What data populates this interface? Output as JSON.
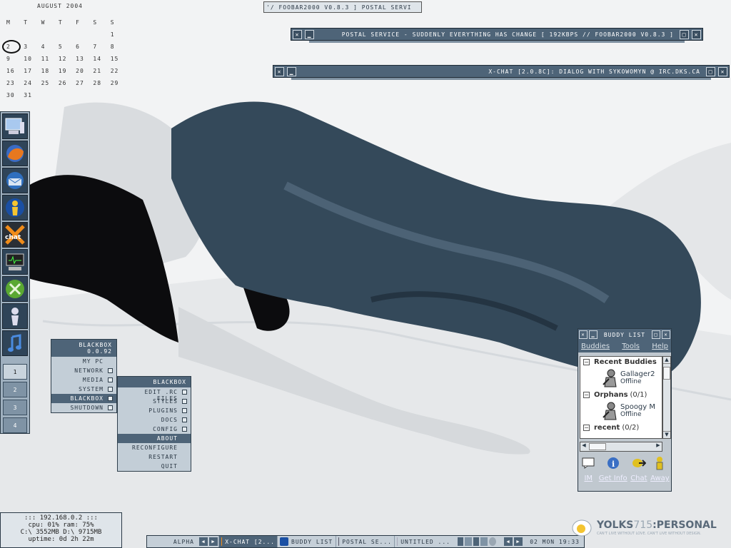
{
  "calendar": {
    "month": "AUGUST 2004",
    "weekdays": [
      "M",
      "T",
      "W",
      "T",
      "F",
      "S",
      "S"
    ],
    "weeks": [
      [
        "",
        "",
        "",
        "",
        "",
        "",
        "1"
      ],
      [
        "2",
        "3",
        "4",
        "5",
        "6",
        "7",
        "8"
      ],
      [
        "9",
        "10",
        "11",
        "12",
        "13",
        "14",
        "15"
      ],
      [
        "16",
        "17",
        "18",
        "19",
        "20",
        "21",
        "22"
      ],
      [
        "23",
        "24",
        "25",
        "26",
        "27",
        "28",
        "29"
      ],
      [
        "30",
        "31",
        "",
        "",
        "",
        "",
        ""
      ]
    ],
    "today": "2"
  },
  "windows": {
    "foobar_tab": "'/ FOOBAR2000 V0.8.3 ]      POSTAL SERVI",
    "foobar_title": "POSTAL SERVICE - SUDDENLY EVERYTHING HAS CHANGE  [ 192KBPS // FOOBAR2000 V0.8.3 ]",
    "xchat_title": "X-CHAT [2.0.8C]: DIALOG WITH SYKOWOMYN @ IRC.DKS.CA"
  },
  "dock": {
    "icons": [
      "my-computer-icon",
      "firefox-icon",
      "thunderbird-icon",
      "aim-icon",
      "xchat-icon",
      "terminal-icon",
      "xbox-icon",
      "figure-icon",
      "music-note-icon"
    ],
    "workspaces": [
      "1",
      "2",
      "3",
      "4"
    ],
    "current_workspace": "1"
  },
  "blackbox_menu": {
    "title": "BLACKBOX 0.0.92",
    "items": [
      {
        "label": "MY PC",
        "sub": false
      },
      {
        "label": "NETWORK",
        "sub": true
      },
      {
        "label": "MEDIA",
        "sub": true
      },
      {
        "label": "SYSTEM",
        "sub": true
      },
      {
        "label": "BLACKBOX",
        "sub": true,
        "selected": true
      },
      {
        "label": "SHUTDOWN",
        "sub": true
      }
    ]
  },
  "blackbox_submenu": {
    "title": "BLACKBOX",
    "items": [
      {
        "label": "EDIT .RC FILES",
        "sub": true
      },
      {
        "label": "STYLES",
        "sub": true
      },
      {
        "label": "PLUGINS",
        "sub": true
      },
      {
        "label": "DOCS",
        "sub": true
      },
      {
        "label": "CONFIG",
        "sub": true
      },
      {
        "label": "ABOUT",
        "sub": false,
        "selected": true
      },
      {
        "label": "RECONFIGURE",
        "sub": false
      },
      {
        "label": "RESTART",
        "sub": false
      },
      {
        "label": "QUIT",
        "sub": false
      }
    ]
  },
  "buddy_list": {
    "title": "BUDDY LIST",
    "menu": [
      "Buddies",
      "Tools",
      "Help"
    ],
    "groups": [
      {
        "name": "Recent Buddies",
        "count": "",
        "buddies": [
          {
            "name": "Gallager2",
            "status": "Offline"
          }
        ]
      },
      {
        "name": "Orphans",
        "count": "(0/1)",
        "buddies": [
          {
            "name": "Spoogy M",
            "status": "Offline"
          }
        ]
      },
      {
        "name": "recent",
        "count": "(0/2)",
        "buddies": []
      }
    ],
    "actions": [
      {
        "label": "IM",
        "icon": "im-icon"
      },
      {
        "label": "Get Info",
        "icon": "info-icon"
      },
      {
        "label": "Chat",
        "icon": "chat-icon"
      },
      {
        "label": "Away",
        "icon": "away-icon"
      }
    ]
  },
  "sysinfo": {
    "ip": "::: 192.168.0.2 :::",
    "cpu_ram": "cpu: 01%     ram: 75%",
    "disks": "C:\\ 3552MB  D:\\ 9715MB",
    "uptime": "uptime: 0d 2h 22m"
  },
  "taskbar": {
    "workspace": "ALPHA",
    "tasks": [
      {
        "label": "X-CHAT [2...",
        "current": true,
        "icon": "xchat-icon"
      },
      {
        "label": "BUDDY LIST",
        "current": false,
        "icon": "aim-icon"
      },
      {
        "label": "POSTAL SE...",
        "current": false,
        "icon": "foobar-icon"
      },
      {
        "label": "UNTITLED ...",
        "current": false,
        "icon": "notepad-icon"
      }
    ],
    "clock": "02 MON 19:33"
  },
  "logo": {
    "name_dark": "YOLKS",
    "name_light": "715",
    "name_suffix": ":PERSONAL",
    "tagline": "CAN'T LIVE WITHOUT LOVE. CAN'T LIVE WITHOUT DESIGN."
  },
  "colors": {
    "accent": "#4e6478",
    "panel": "#c3ced7",
    "dress": "#34495a"
  }
}
